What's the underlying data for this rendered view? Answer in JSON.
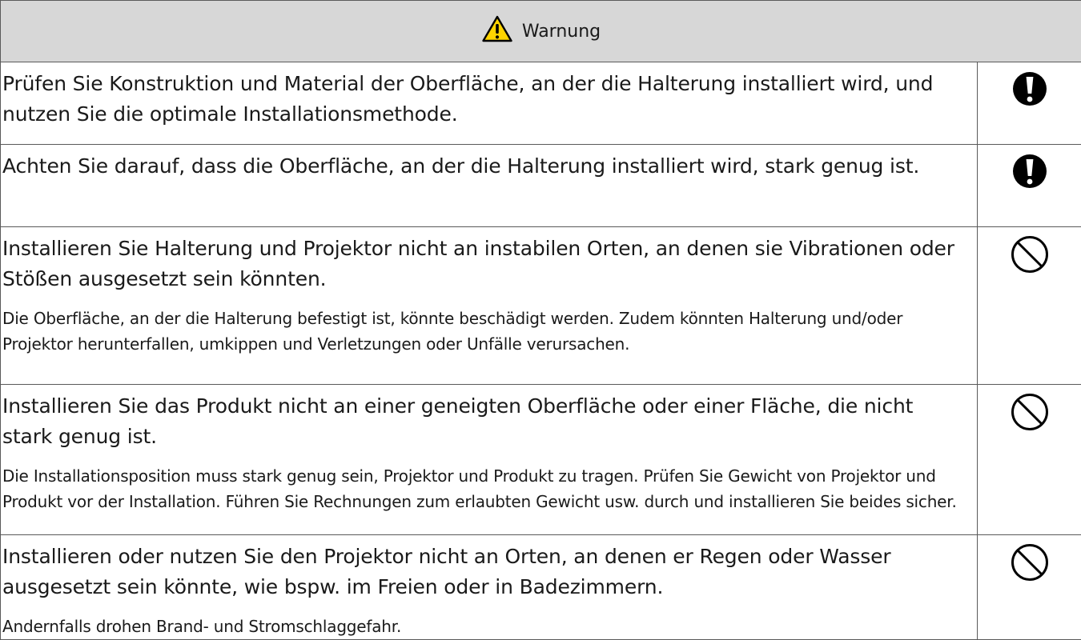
{
  "header": {
    "title": "Warnung",
    "icon": "warning-triangle-icon"
  },
  "rows": [
    {
      "main": "Prüfen Sie Konstruktion und Material der Oberfläche, an der die Halterung installiert wird, und nutzen Sie die optimale Installationsmethode.",
      "icon": "mandatory-exclamation-icon"
    },
    {
      "main": "Achten Sie darauf, dass die Oberfläche, an der die Halterung installiert wird, stark genug ist.",
      "icon": "mandatory-exclamation-icon"
    },
    {
      "main": "Installieren Sie Halterung und Projektor nicht an instabilen Orten, an denen sie Vibrationen oder Stößen ausgesetzt sein könnten.",
      "detail": "Die Oberfläche, an der die Halterung befestigt ist, könnte beschädigt werden. Zudem könnten Halterung und/oder Projektor herunterfallen, umkippen und Verletzungen oder Unfälle verursachen.",
      "icon": "prohibition-icon"
    },
    {
      "main": "Installieren Sie das Produkt nicht an einer geneigten Oberfläche oder einer Fläche, die nicht stark genug ist.",
      "detail": "Die Installationsposition muss stark genug sein, Projektor und Produkt zu tragen. Prüfen Sie Gewicht von Projektor und Produkt vor der Installation. Führen Sie Rechnungen zum erlaubten Gewicht usw. durch und installieren Sie beides sicher.",
      "icon": "prohibition-icon"
    },
    {
      "main": "Installieren oder nutzen Sie den Projektor nicht an Orten, an denen er Regen oder Wasser ausgesetzt sein könnte, wie bspw. im Freien oder in Badezimmern.",
      "detail": "Andernfalls drohen Brand- und Stromschlaggefahr.",
      "icon": "prohibition-icon"
    }
  ],
  "colors": {
    "header_bg": "#d7d7d7",
    "warning_yellow": "#ffd400",
    "border": "#5a5a5a",
    "text": "#1a1a1a"
  }
}
